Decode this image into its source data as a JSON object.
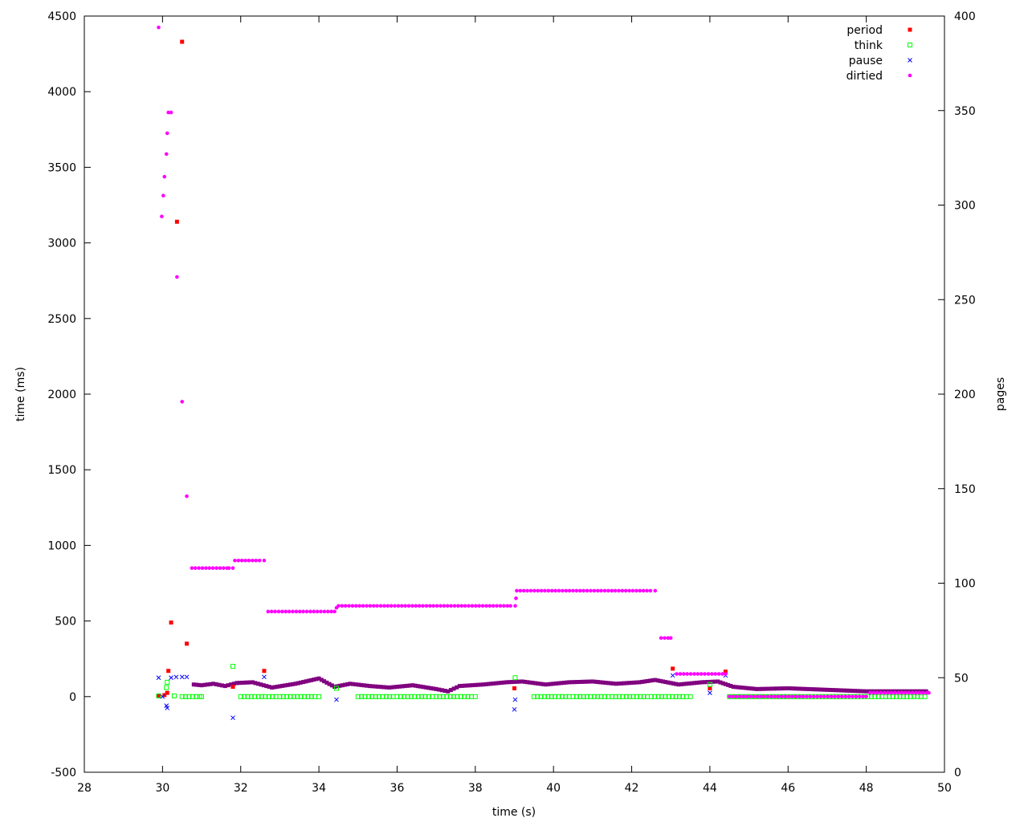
{
  "chart_data": {
    "type": "scatter",
    "xlabel": "time (s)",
    "ylabel": "time (ms)",
    "y2label": "pages",
    "xlim": [
      28,
      50
    ],
    "ylim": [
      -500,
      4500
    ],
    "y2lim": [
      0,
      400
    ],
    "x_ticks": [
      28,
      30,
      32,
      34,
      36,
      38,
      40,
      42,
      44,
      46,
      48,
      50
    ],
    "y_ticks": [
      -500,
      0,
      500,
      1000,
      1500,
      2000,
      2500,
      3000,
      3500,
      4000,
      4500
    ],
    "y2_ticks": [
      0,
      50,
      100,
      150,
      200,
      250,
      300,
      350,
      400
    ],
    "grid": false,
    "legend_position": "top-right",
    "series": [
      {
        "name": "period",
        "axis": "y",
        "color": "#ff0000",
        "marker": "filled-square",
        "points": [
          [
            29.9,
            5
          ],
          [
            30.05,
            10
          ],
          [
            30.12,
            25
          ],
          [
            30.15,
            170
          ],
          [
            30.22,
            490
          ],
          [
            30.37,
            3140
          ],
          [
            30.5,
            4330
          ],
          [
            30.62,
            350
          ],
          [
            31.8,
            65
          ],
          [
            32.6,
            170
          ],
          [
            39.0,
            55
          ],
          [
            43.05,
            185
          ],
          [
            44.0,
            55
          ],
          [
            44.4,
            165
          ]
        ]
      },
      {
        "name": "think",
        "axis": "y",
        "color": "#00ff00",
        "marker": "open-square",
        "points": [
          [
            29.9,
            5
          ],
          [
            30.1,
            60
          ],
          [
            30.12,
            95
          ],
          [
            31.8,
            200
          ],
          [
            34.45,
            55
          ],
          [
            39.02,
            125
          ],
          [
            44.0,
            80
          ],
          [
            30.3,
            5
          ],
          [
            30.5,
            0
          ],
          [
            31.0,
            0
          ],
          [
            32.0,
            0
          ],
          [
            33.0,
            0
          ],
          [
            34.0,
            0
          ],
          [
            35.0,
            0
          ],
          [
            36.0,
            0
          ],
          [
            37.0,
            0
          ],
          [
            38.0,
            0
          ],
          [
            39.5,
            0
          ],
          [
            40.5,
            0
          ],
          [
            41.5,
            0
          ],
          [
            42.5,
            0
          ],
          [
            43.5,
            0
          ],
          [
            44.5,
            0
          ],
          [
            45.5,
            0
          ],
          [
            46.5,
            0
          ],
          [
            47.5,
            0
          ],
          [
            48.5,
            0
          ],
          [
            49.5,
            0
          ]
        ]
      },
      {
        "name": "pause",
        "axis": "y",
        "color": "#0000ff",
        "marker": "cross",
        "points": [
          [
            29.9,
            125
          ],
          [
            30.0,
            0
          ],
          [
            30.1,
            -60
          ],
          [
            30.12,
            -75
          ],
          [
            30.22,
            125
          ],
          [
            30.35,
            130
          ],
          [
            30.5,
            130
          ],
          [
            30.62,
            130
          ],
          [
            31.8,
            -140
          ],
          [
            32.6,
            130
          ],
          [
            34.45,
            -20
          ],
          [
            39.0,
            -85
          ],
          [
            39.02,
            -20
          ],
          [
            43.05,
            140
          ],
          [
            44.0,
            25
          ],
          [
            44.4,
            140
          ]
        ]
      },
      {
        "name": "dirtied",
        "axis": "y2",
        "color": "#ff00ff",
        "marker": "filled-circle",
        "points": [
          [
            29.9,
            394
          ],
          [
            29.98,
            294
          ],
          [
            30.02,
            305
          ],
          [
            30.05,
            315
          ],
          [
            30.1,
            327
          ],
          [
            30.12,
            338
          ],
          [
            30.15,
            349
          ],
          [
            30.22,
            349
          ],
          [
            30.37,
            262
          ],
          [
            30.5,
            196
          ],
          [
            30.62,
            146
          ],
          [
            30.75,
            108
          ],
          [
            31.7,
            108
          ],
          [
            31.8,
            108
          ],
          [
            31.85,
            112
          ],
          [
            32.6,
            112
          ],
          [
            32.7,
            85
          ],
          [
            34.4,
            85
          ],
          [
            34.45,
            87
          ],
          [
            34.5,
            88
          ],
          [
            38.9,
            88
          ],
          [
            39.02,
            88
          ],
          [
            39.04,
            92
          ],
          [
            39.06,
            96
          ],
          [
            42.6,
            96
          ],
          [
            42.75,
            71
          ],
          [
            43.0,
            71
          ],
          [
            43.15,
            52
          ],
          [
            44.4,
            52
          ],
          [
            44.5,
            40
          ],
          [
            48.0,
            40
          ],
          [
            48.1,
            42
          ],
          [
            49.6,
            42
          ]
        ]
      }
    ],
    "trend_bands": [
      {
        "color": "#800080",
        "axis": "y",
        "note": "overlapping period/pause markers rendered dark purple",
        "points": [
          [
            30.8,
            80
          ],
          [
            31.0,
            75
          ],
          [
            31.3,
            85
          ],
          [
            31.6,
            70
          ],
          [
            31.9,
            90
          ],
          [
            32.3,
            95
          ],
          [
            32.8,
            60
          ],
          [
            33.4,
            85
          ],
          [
            34.0,
            120
          ],
          [
            34.4,
            65
          ],
          [
            34.8,
            85
          ],
          [
            35.3,
            70
          ],
          [
            35.8,
            60
          ],
          [
            36.4,
            75
          ],
          [
            37.0,
            50
          ],
          [
            37.3,
            35
          ],
          [
            37.6,
            70
          ],
          [
            38.2,
            80
          ],
          [
            38.8,
            95
          ],
          [
            39.2,
            100
          ],
          [
            39.8,
            80
          ],
          [
            40.4,
            95
          ],
          [
            41.0,
            100
          ],
          [
            41.6,
            85
          ],
          [
            42.2,
            95
          ],
          [
            42.6,
            110
          ],
          [
            43.2,
            80
          ],
          [
            43.8,
            95
          ],
          [
            44.2,
            100
          ],
          [
            44.6,
            65
          ],
          [
            45.2,
            50
          ],
          [
            46.0,
            55
          ],
          [
            47.0,
            45
          ],
          [
            48.0,
            35
          ],
          [
            49.6,
            35
          ]
        ]
      }
    ]
  }
}
